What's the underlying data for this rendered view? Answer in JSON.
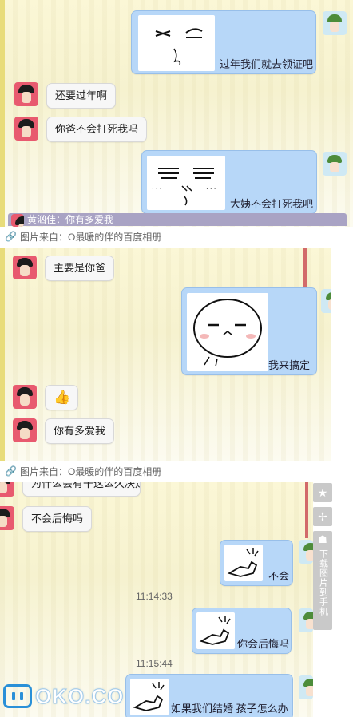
{
  "screenshot1": {
    "messages": [
      {
        "side": "right",
        "sticker": "squint-face-sticker",
        "text": "过年我们就去领证吧"
      },
      {
        "side": "left",
        "text": "还要过年啊"
      },
      {
        "side": "left",
        "text": "你爸不会打死我吗"
      },
      {
        "side": "right",
        "sticker": "squint-face-sticker",
        "text": "大姨不会打死我吧"
      }
    ],
    "status_strip": "黄汹佳：你有多爱我"
  },
  "caption_label": "图片来自：O最暖的伴的百度相册",
  "screenshot2": {
    "messages": [
      {
        "side": "left",
        "text": "主要是你爸"
      },
      {
        "side": "right",
        "sticker": "bun-face-sticker",
        "text": "我来搞定"
      },
      {
        "side": "left",
        "emoji": "👍"
      },
      {
        "side": "left",
        "text": "你有多爱我"
      }
    ]
  },
  "screenshot3": {
    "messages": [
      {
        "side": "left",
        "text": "为什么会有干这么久决定"
      },
      {
        "side": "left",
        "text": "不会后悔吗"
      },
      {
        "side": "right",
        "sticker": "rage-hand-sticker",
        "text": "不会"
      },
      {
        "side": "time",
        "text": "11:14:33"
      },
      {
        "side": "right",
        "sticker": "rage-hand-sticker",
        "text": "你会后悔吗"
      },
      {
        "side": "time",
        "text": "11:15:44"
      },
      {
        "side": "right",
        "sticker": "rage-hand-sticker",
        "text": "如果我们结婚 孩子怎么办"
      }
    ],
    "side_tools": {
      "star": "★",
      "move": "✢",
      "android": "☗",
      "download_label": "下载图片到手机"
    }
  },
  "watermark": {
    "text": "OKO.CO"
  }
}
